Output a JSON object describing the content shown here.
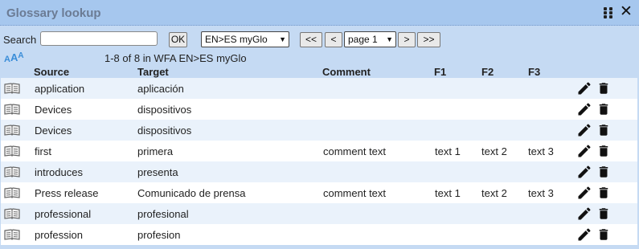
{
  "window": {
    "title": "Glossary lookup"
  },
  "toolbar": {
    "search_label": "Search",
    "search_value": "",
    "ok_label": "OK",
    "glossary_select": "EN>ES myGlo",
    "first_label": "<<",
    "prev_label": "<",
    "page_select": "page 1",
    "next_label": ">",
    "last_label": ">>",
    "font_sizes": [
      "A",
      "A",
      "A"
    ],
    "status": "1-8 of 8 in WFA EN>ES myGlo"
  },
  "columns": {
    "source": "Source",
    "target": "Target",
    "comment": "Comment",
    "f1": "F1",
    "f2": "F2",
    "f3": "F3"
  },
  "rows": [
    {
      "source": "application",
      "target": "aplicación",
      "comment": "",
      "f1": "",
      "f2": "",
      "f3": ""
    },
    {
      "source": "Devices",
      "target": "dispositivos",
      "comment": "",
      "f1": "",
      "f2": "",
      "f3": ""
    },
    {
      "source": "Devices",
      "target": "dispositivos",
      "comment": "",
      "f1": "",
      "f2": "",
      "f3": ""
    },
    {
      "source": "first",
      "target": "primera",
      "comment": "comment text",
      "f1": "text 1",
      "f2": "text 2",
      "f3": "text 3"
    },
    {
      "source": "introduces",
      "target": "presenta",
      "comment": "",
      "f1": "",
      "f2": "",
      "f3": ""
    },
    {
      "source": "Press release",
      "target": "Comunicado de prensa",
      "comment": "comment text",
      "f1": "text 1",
      "f2": "text 2",
      "f3": "text 3"
    },
    {
      "source": "professional",
      "target": "profesional",
      "comment": "",
      "f1": "",
      "f2": "",
      "f3": ""
    },
    {
      "source": "profession",
      "target": "profesion",
      "comment": "",
      "f1": "",
      "f2": "",
      "f3": ""
    }
  ],
  "icons": {
    "drag": "drag-handle-icon",
    "close": "close-icon",
    "book": "book-icon",
    "edit": "pencil-icon",
    "delete": "trash-icon"
  },
  "colors": {
    "titlebar": "#a6c7ee",
    "panel": "#c5daf3",
    "row_alt": "#eaf2fb",
    "accent": "#3a8dd8"
  }
}
